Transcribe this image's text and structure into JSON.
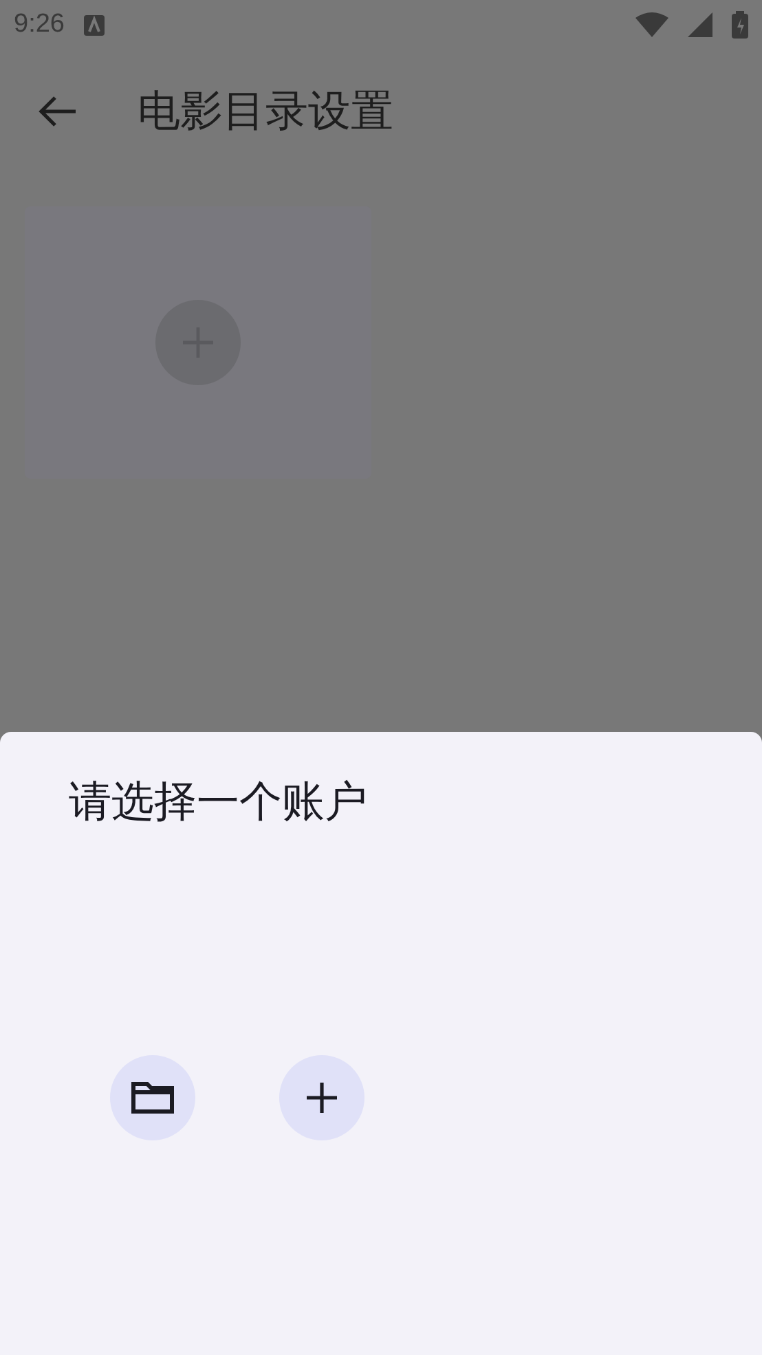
{
  "status_bar": {
    "time": "9:26"
  },
  "app_bar": {
    "title": "电影目录设置"
  },
  "sheet": {
    "title": "请选择一个账户",
    "actions": [
      {
        "kind": "folder"
      },
      {
        "kind": "add"
      }
    ]
  }
}
